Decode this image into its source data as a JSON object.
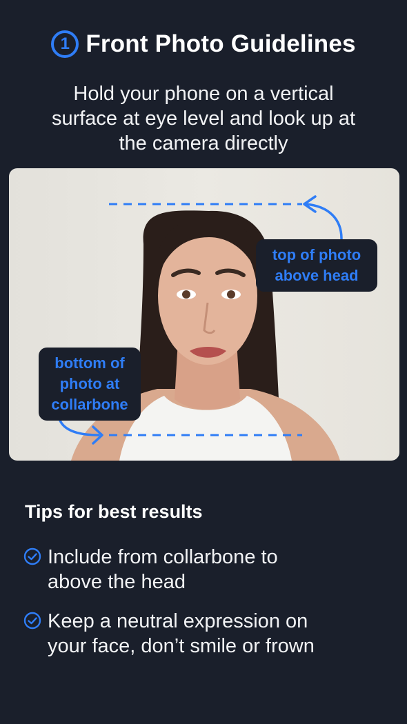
{
  "header": {
    "step_number": "1",
    "title": "Front Photo Guidelines"
  },
  "subtitle_lines": [
    "Hold your phone on a vertical",
    "surface at eye level and look up at",
    "the camera directly"
  ],
  "photo": {
    "callout_top_lines": [
      "top of photo",
      "above head"
    ],
    "callout_bottom_lines": [
      "bottom of",
      "photo at",
      "collarbone"
    ]
  },
  "tips": {
    "title": "Tips for best results",
    "items": [
      {
        "lines": [
          "Include from collarbone to",
          "above the head"
        ]
      },
      {
        "lines": [
          "Keep a neutral expression on",
          "your face, don’t smile or frown"
        ]
      }
    ]
  },
  "colors": {
    "background": "#1a1f2b",
    "accent": "#2f7df6",
    "text": "#ffffff"
  }
}
